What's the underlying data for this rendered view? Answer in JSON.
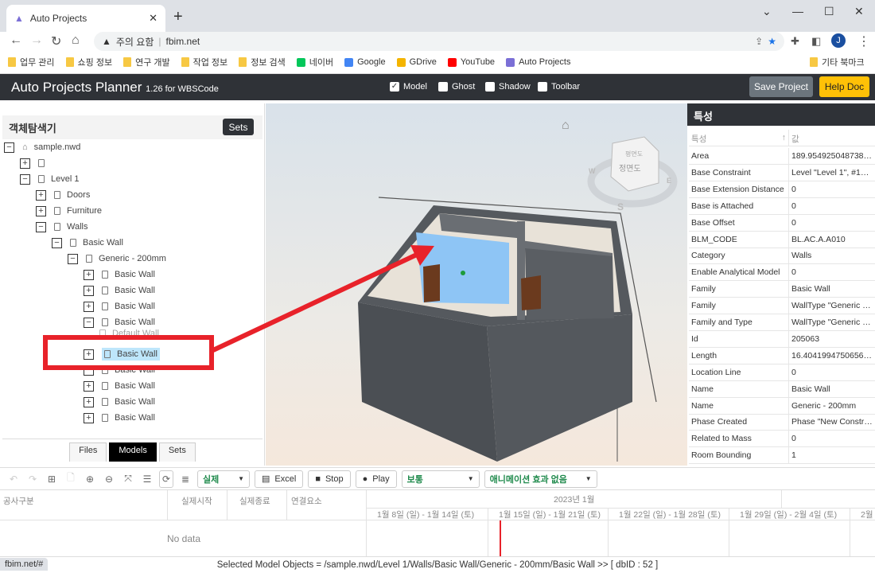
{
  "browser": {
    "tab_title": "Auto Projects",
    "warning": "주의 요함",
    "url": "fbim.net",
    "profile": "J",
    "bookmarks": [
      {
        "label": "업무 관리",
        "icon": "folder"
      },
      {
        "label": "쇼핑 정보",
        "icon": "folder"
      },
      {
        "label": "연구 개발",
        "icon": "folder"
      },
      {
        "label": "작업 정보",
        "icon": "folder"
      },
      {
        "label": "정보 검색",
        "icon": "folder"
      },
      {
        "label": "네이버",
        "icon": "naver"
      },
      {
        "label": "Google",
        "icon": "google"
      },
      {
        "label": "GDrive",
        "icon": "gdrive"
      },
      {
        "label": "YouTube",
        "icon": "youtube"
      },
      {
        "label": "Auto Projects",
        "icon": "autoprojects"
      }
    ],
    "other_bookmarks": "기타 북마크",
    "status_url": "fbim.net/#"
  },
  "app": {
    "title": "Auto Projects Planner",
    "version": "1.26 for WBSCode",
    "checks": [
      {
        "label": "Model",
        "checked": true
      },
      {
        "label": "Ghost",
        "checked": false
      },
      {
        "label": "Shadow",
        "checked": false
      },
      {
        "label": "Toolbar",
        "checked": false
      }
    ],
    "save": "Save Project",
    "help": "Help Doc"
  },
  "explorer": {
    "title": "객체탐색기",
    "sets": "Sets",
    "tree": [
      {
        "level": 0,
        "toggle": "-",
        "label": "sample.nwd",
        "icon": "home"
      },
      {
        "level": 1,
        "toggle": "+",
        "label": "",
        "icon": "doc"
      },
      {
        "level": 1,
        "toggle": "-",
        "label": "Level 1",
        "icon": "doc"
      },
      {
        "level": 2,
        "toggle": "+",
        "label": "Doors",
        "icon": "doc"
      },
      {
        "level": 2,
        "toggle": "+",
        "label": "Furniture",
        "icon": "doc"
      },
      {
        "level": 2,
        "toggle": "-",
        "label": "Walls",
        "icon": "doc"
      },
      {
        "level": 3,
        "toggle": "-",
        "label": "Basic Wall",
        "icon": "doc"
      },
      {
        "level": 4,
        "toggle": "-",
        "label": "Generic - 200mm",
        "icon": "doc"
      },
      {
        "level": 5,
        "toggle": "+",
        "label": "Basic Wall",
        "icon": "doc"
      },
      {
        "level": 5,
        "toggle": "+",
        "label": "Basic Wall",
        "icon": "doc"
      },
      {
        "level": 5,
        "toggle": "+",
        "label": "Basic Wall",
        "icon": "doc"
      },
      {
        "level": 5,
        "toggle": "-",
        "label": "Basic Wall",
        "icon": "doc"
      },
      {
        "level": 6,
        "toggle": "",
        "label": "Default Wall",
        "icon": "doc"
      },
      {
        "level": 5,
        "toggle": "+",
        "label": "Basic Wall",
        "icon": "doc",
        "selected": true
      },
      {
        "level": 5,
        "toggle": "-",
        "label": "Basic Wall",
        "icon": "doc"
      },
      {
        "level": 5,
        "toggle": "+",
        "label": "Basic Wall",
        "icon": "doc"
      },
      {
        "level": 5,
        "toggle": "+",
        "label": "Basic Wall",
        "icon": "doc"
      },
      {
        "level": 5,
        "toggle": "+",
        "label": "Basic Wall",
        "icon": "doc"
      }
    ],
    "tabs": [
      {
        "label": "Files"
      },
      {
        "label": "Models",
        "active": true
      },
      {
        "label": "Sets"
      }
    ]
  },
  "viewer": {
    "viewcube_top": "평면도",
    "viewcube_front": "정면도",
    "compass": [
      "W",
      "E",
      "S"
    ]
  },
  "properties": {
    "title": "특성",
    "col_key": "특성",
    "col_value": "값",
    "rows": [
      [
        "Area",
        "189.95492504873897"
      ],
      [
        "Base Constraint",
        "Level \"Level 1\", #13071"
      ],
      [
        "Base Extension Distance",
        "0"
      ],
      [
        "Base is Attached",
        "0"
      ],
      [
        "Base Offset",
        "0"
      ],
      [
        "BLM_CODE",
        "BL.AC.A.A010"
      ],
      [
        "Category",
        "Walls"
      ],
      [
        "Enable Analytical Model",
        "0"
      ],
      [
        "Family",
        "Basic Wall"
      ],
      [
        "Family",
        "WallType \"Generic - 2..."
      ],
      [
        "Family and Type",
        "WallType \"Generic - 2..."
      ],
      [
        "Id",
        "205063"
      ],
      [
        "Length",
        "16.404199475065617"
      ],
      [
        "Location Line",
        "0"
      ],
      [
        "Name",
        "Basic Wall"
      ],
      [
        "Name",
        "Generic - 200mm"
      ],
      [
        "Phase Created",
        "Phase \"New Construc..."
      ],
      [
        "Related to Mass",
        "0"
      ],
      [
        "Room Bounding",
        "1"
      ]
    ]
  },
  "toolbar": {
    "mode": "실제",
    "excel": "Excel",
    "stop": "Stop",
    "play": "Play",
    "speed": "보통",
    "animation": "애니메이션 효과 없음"
  },
  "gantt": {
    "columns": [
      "공사구분",
      "실제시작",
      "실제종료",
      "연결요소"
    ],
    "month": "2023년 1월",
    "weeks": [
      "1월 8일 (일) - 1월 14일 (토)",
      "1월 15일 (일) - 1월 21일 (토)",
      "1월 22일 (일) - 1월 28일 (토)",
      "1월 29일 (일) - 2월 4일 (토)",
      "2월"
    ],
    "empty": "No data"
  },
  "status": "Selected Model Objects = /sample.nwd/Level 1/Walls/Basic Wall/Generic - 200mm/Basic Wall >> [ dbID : 52 ]",
  "colors": {
    "header": "#2f3237",
    "help": "#ffc107",
    "selection": "#8ec5f5",
    "annotation": "#e8222a"
  }
}
